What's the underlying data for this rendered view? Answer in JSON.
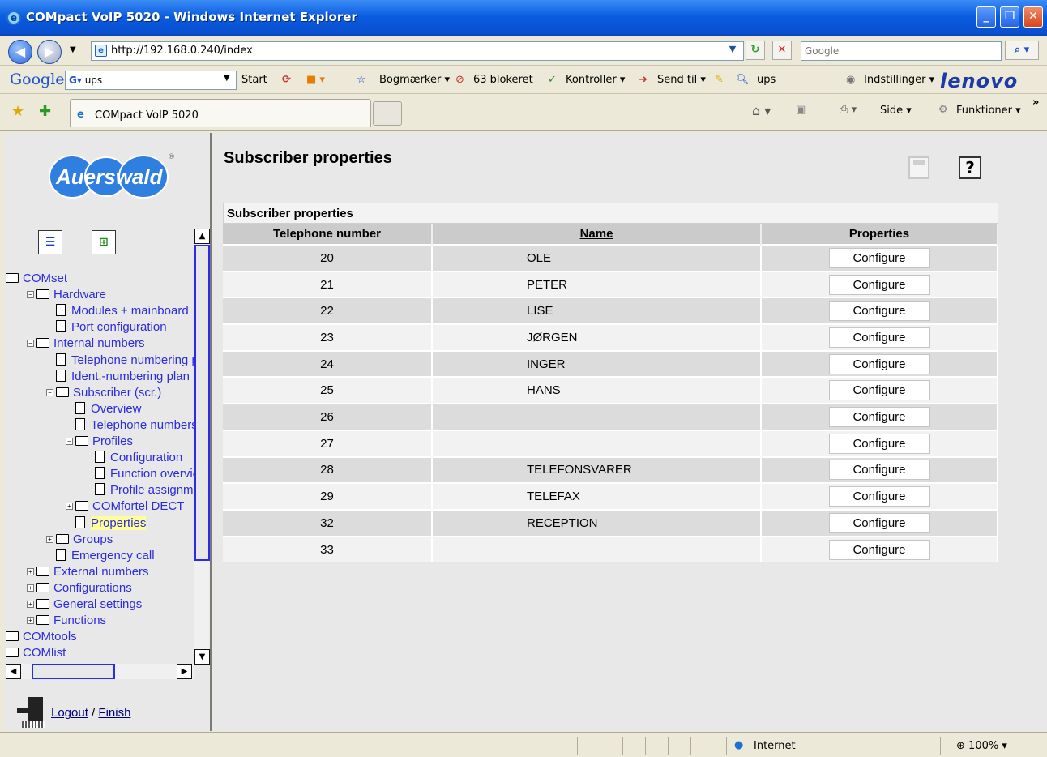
{
  "window": {
    "title": "COMpact VoIP 5020 - Windows Internet Explorer",
    "minimize": "_",
    "maximize": "❐",
    "close": "✕"
  },
  "address": {
    "url": "http://192.168.0.240/index",
    "search_placeholder": "Google"
  },
  "google_toolbar": {
    "logo": "Google",
    "query": "ups",
    "start": "Start",
    "bookmarks": "Bogmærker",
    "blocked": "63 blokeret",
    "check": "Kontroller",
    "send": "Send til",
    "ups": "ups",
    "settings": "Indstillinger",
    "brand": "lenovo"
  },
  "tabs": {
    "active": "COMpact VoIP 5020",
    "page": "Side",
    "tools": "Funktioner"
  },
  "sidebar": {
    "logo": "Auerswald",
    "tree": [
      {
        "label": "COMset",
        "type": "folder",
        "indent": 0,
        "pm": ""
      },
      {
        "label": "Hardware",
        "type": "folder",
        "indent": 1,
        "pm": "−"
      },
      {
        "label": "Modules + mainboard",
        "type": "doc",
        "indent": 2,
        "pm": ""
      },
      {
        "label": "Port configuration",
        "type": "doc",
        "indent": 2,
        "pm": ""
      },
      {
        "label": "Internal numbers",
        "type": "folder",
        "indent": 1,
        "pm": "−"
      },
      {
        "label": "Telephone numbering p",
        "type": "doc",
        "indent": 2,
        "pm": ""
      },
      {
        "label": "Ident.-numbering plan",
        "type": "doc",
        "indent": 2,
        "pm": ""
      },
      {
        "label": "Subscriber (scr.)",
        "type": "folder",
        "indent": 2,
        "pm": "−"
      },
      {
        "label": "Overview",
        "type": "doc",
        "indent": 3,
        "pm": ""
      },
      {
        "label": "Telephone numbers",
        "type": "doc",
        "indent": 3,
        "pm": ""
      },
      {
        "label": "Profiles",
        "type": "folder",
        "indent": 3,
        "pm": "−"
      },
      {
        "label": "Configuration",
        "type": "doc",
        "indent": 4,
        "pm": ""
      },
      {
        "label": "Function overvie",
        "type": "doc",
        "indent": 4,
        "pm": ""
      },
      {
        "label": "Profile assignme",
        "type": "doc",
        "indent": 4,
        "pm": ""
      },
      {
        "label": "COMfortel DECT",
        "type": "folder",
        "indent": 3,
        "pm": "+"
      },
      {
        "label": "Properties",
        "type": "doc",
        "indent": 3,
        "pm": "",
        "selected": true
      },
      {
        "label": "Groups",
        "type": "folder",
        "indent": 2,
        "pm": "+"
      },
      {
        "label": "Emergency call",
        "type": "doc",
        "indent": 2,
        "pm": ""
      },
      {
        "label": "External numbers",
        "type": "folder",
        "indent": 1,
        "pm": "+"
      },
      {
        "label": "Configurations",
        "type": "folder",
        "indent": 1,
        "pm": "+"
      },
      {
        "label": "General settings",
        "type": "folder",
        "indent": 1,
        "pm": "+"
      },
      {
        "label": "Functions",
        "type": "folder",
        "indent": 1,
        "pm": "+"
      },
      {
        "label": "COMtools",
        "type": "folder",
        "indent": 0,
        "pm": ""
      },
      {
        "label": "COMlist",
        "type": "folder",
        "indent": 0,
        "pm": ""
      }
    ],
    "logout": "Logout",
    "separator": "/",
    "finish": "Finish"
  },
  "main": {
    "title": "Subscriber properties",
    "table_caption": "Subscriber properties",
    "columns": [
      "Telephone number",
      "Name",
      "Properties"
    ],
    "rows": [
      {
        "number": "20",
        "name": "OLE",
        "action": "Configure"
      },
      {
        "number": "21",
        "name": "PETER",
        "action": "Configure"
      },
      {
        "number": "22",
        "name": "LISE",
        "action": "Configure"
      },
      {
        "number": "23",
        "name": "JØRGEN",
        "action": "Configure"
      },
      {
        "number": "24",
        "name": "INGER",
        "action": "Configure"
      },
      {
        "number": "25",
        "name": "HANS",
        "action": "Configure"
      },
      {
        "number": "26",
        "name": "",
        "action": "Configure"
      },
      {
        "number": "27",
        "name": "",
        "action": "Configure"
      },
      {
        "number": "28",
        "name": "TELEFONSVARER",
        "action": "Configure"
      },
      {
        "number": "29",
        "name": "TELEFAX",
        "action": "Configure"
      },
      {
        "number": "32",
        "name": "RECEPTION",
        "action": "Configure"
      },
      {
        "number": "33",
        "name": "",
        "action": "Configure"
      }
    ]
  },
  "status": {
    "zone": "Internet",
    "zoom": "100%"
  }
}
